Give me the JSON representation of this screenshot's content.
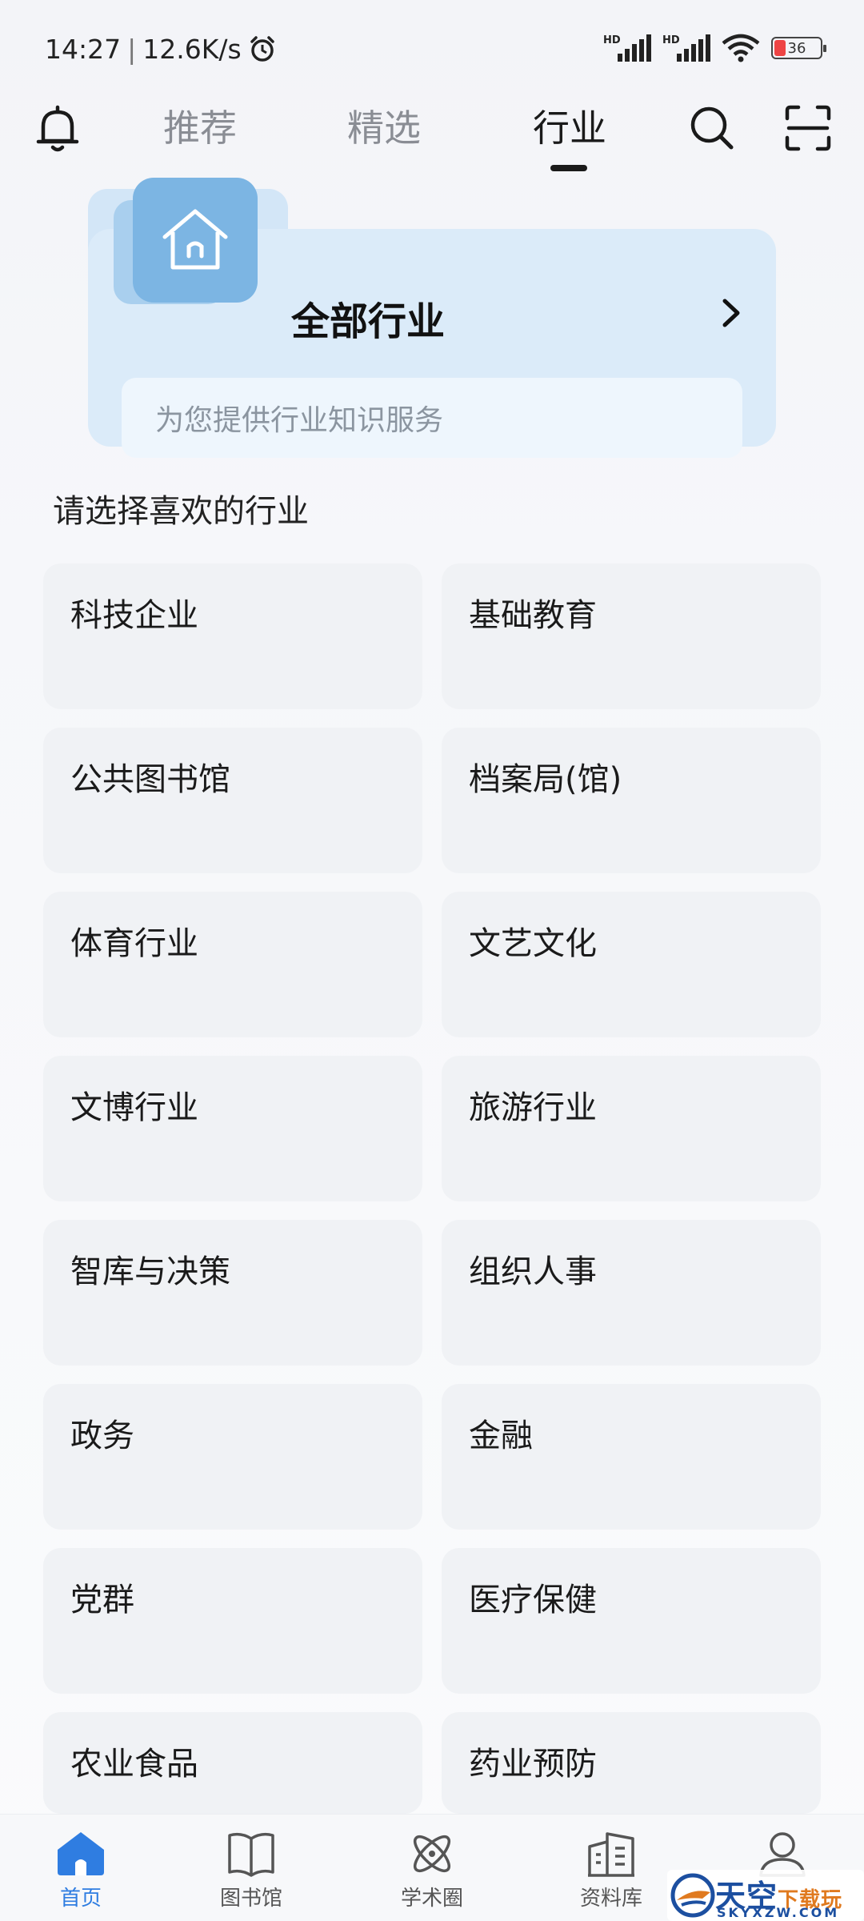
{
  "status_bar": {
    "time": "14:27",
    "network_speed": "12.6K/s",
    "signal_1_label": "HD",
    "signal_2_label": "HD",
    "battery": "36",
    "icons": [
      "alarm-icon",
      "signal-icon",
      "signal-icon",
      "wifi-icon",
      "battery-icon"
    ]
  },
  "top_nav": {
    "tabs": [
      {
        "label": "推荐",
        "active": false
      },
      {
        "label": "精选",
        "active": false
      },
      {
        "label": "行业",
        "active": true
      }
    ],
    "icons": [
      "bell-icon",
      "search-icon",
      "scan-icon"
    ]
  },
  "hero": {
    "title": "全部行业",
    "search_placeholder": "为您提供行业知识服务",
    "icon": "house-icon",
    "arrow": "chevron-right-icon"
  },
  "section_title": "请选择喜欢的行业",
  "industries": [
    "科技企业",
    "基础教育",
    "公共图书馆",
    "档案局(馆)",
    "体育行业",
    "文艺文化",
    "文博行业",
    "旅游行业",
    "智库与决策",
    "组织人事",
    "政务",
    "金融",
    "党群",
    "医疗保健",
    "农业食品",
    "药业预防"
  ],
  "bottom_nav": [
    {
      "label": "首页",
      "icon": "home-icon",
      "active": true
    },
    {
      "label": "图书馆",
      "icon": "book-icon",
      "active": false
    },
    {
      "label": "学术圈",
      "icon": "atom-icon",
      "active": false
    },
    {
      "label": "资料库",
      "icon": "building-icon",
      "active": false
    },
    {
      "label": "",
      "icon": "profile-icon",
      "active": false
    }
  ],
  "watermark": {
    "text_main": "天空",
    "text_accent": "下载玩",
    "text_sub": "SKYXZW.COM"
  },
  "colors": {
    "accent_blue": "#2f7de1",
    "hero_bg": "#dbebf9",
    "hero_icon": "#7cb5e3",
    "card_bg": "#f0f2f5"
  }
}
